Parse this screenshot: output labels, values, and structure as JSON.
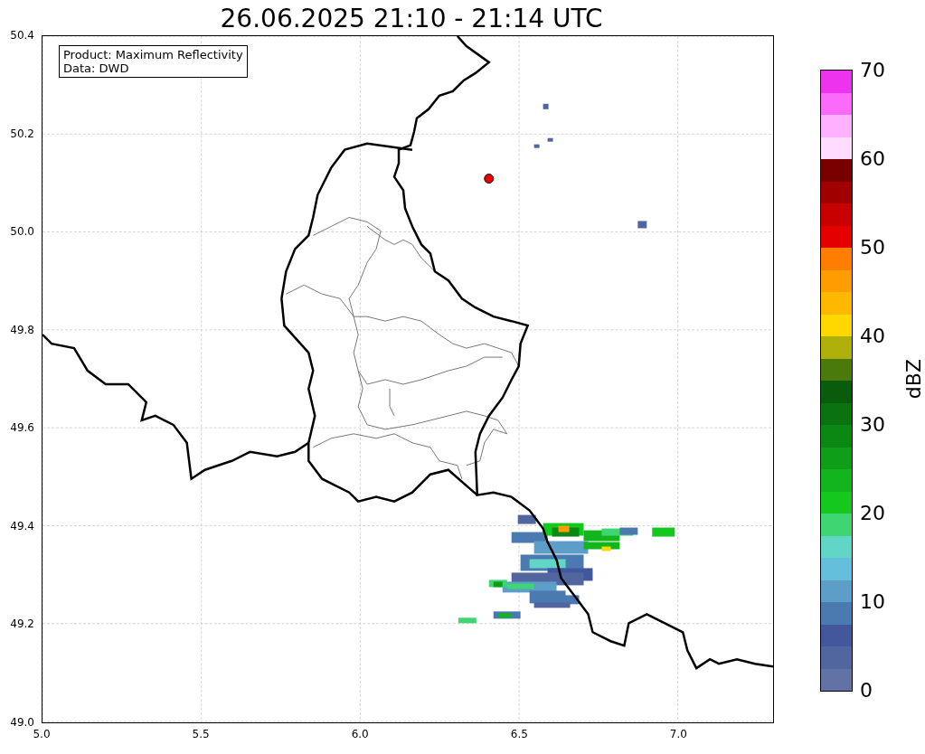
{
  "title": "26.06.2025 21:10 - 21:14 UTC",
  "info_box": {
    "lines": [
      "Product: Maximum Reflectivity",
      "Data: DWD"
    ]
  },
  "map": {
    "xticks": [
      "5.0",
      "5.5",
      "6.0",
      "6.5",
      "7.0"
    ],
    "yticks": [
      "50.4",
      "50.2",
      "50.0",
      "49.8",
      "49.6",
      "49.4",
      "49.2",
      "49.0"
    ]
  },
  "colorbar": {
    "label": "dBZ",
    "ticks": [
      "70",
      "60",
      "50",
      "40",
      "30",
      "20",
      "10",
      "0"
    ],
    "bins": [
      {
        "color": "#6272a4"
      },
      {
        "color": "#51659f"
      },
      {
        "color": "#43589c"
      },
      {
        "color": "#4a7ab0"
      },
      {
        "color": "#5d9ec8"
      },
      {
        "color": "#64bfdc"
      },
      {
        "color": "#62d6c6"
      },
      {
        "color": "#3dd673"
      },
      {
        "color": "#14c81e"
      },
      {
        "color": "#12b51c"
      },
      {
        "color": "#0e9e17"
      },
      {
        "color": "#0b8813"
      },
      {
        "color": "#0a7310"
      },
      {
        "color": "#085c0c"
      },
      {
        "color": "#4a7a0c"
      },
      {
        "color": "#afb00a"
      },
      {
        "color": "#ffd800"
      },
      {
        "color": "#ffb800"
      },
      {
        "color": "#ff9c00"
      },
      {
        "color": "#ff7d00"
      },
      {
        "color": "#e50000"
      },
      {
        "color": "#c80000"
      },
      {
        "color": "#a00000"
      },
      {
        "color": "#7a0000"
      },
      {
        "color": "#ffdcff"
      },
      {
        "color": "#ffb0ff"
      },
      {
        "color": "#fb6afb"
      },
      {
        "color": "#ee33ee"
      }
    ]
  }
}
